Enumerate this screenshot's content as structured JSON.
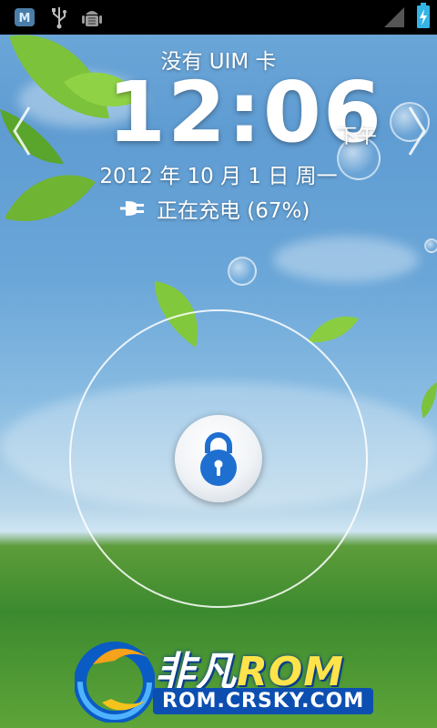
{
  "status_bar": {
    "icons": [
      "m-app-icon",
      "usb-icon",
      "android-debug-icon",
      "signal-icon",
      "battery-charging-icon"
    ]
  },
  "lockscreen": {
    "carrier": "没有 UIM 卡",
    "time": "12:06",
    "ampm": "下午",
    "date": "2012 年 10 月 1 日 周一",
    "charging_text": "正在充电 (67%)",
    "battery_percent": 67
  },
  "watermark": {
    "brand_cn": "非凡",
    "brand_en": "ROM",
    "url": "ROM.CRSKY.COM"
  },
  "colors": {
    "statusbar_bg": "#000000",
    "battery_accent": "#33b5e5",
    "lock_blue": "#1f6fd1"
  }
}
